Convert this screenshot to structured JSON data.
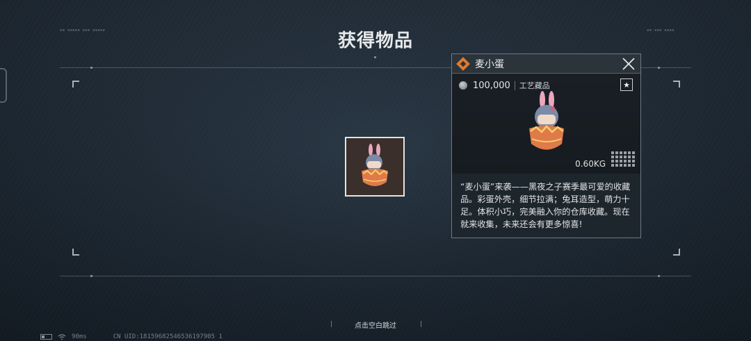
{
  "page": {
    "title": "获得物品",
    "bottom_hint": "点击空白跳过"
  },
  "item_card": {
    "name": "麦小蛋",
    "price": "100,000",
    "category": "工艺藏品",
    "weight": "0.60KG",
    "description": "“麦小蛋”来袭——黑夜之子赛季最可爱的收藏品。彩蛋外壳，细节拉满；兔耳造型，萌力十足。体积小巧，完美融入你的仓库收藏。现在就来收集，未来还会有更多惊喜!",
    "rarity_color": "#e07a2e",
    "icons": {
      "rarity": "diamond-rarity-icon",
      "close": "close-icon",
      "favorite": "star-icon",
      "currency": "coin-icon",
      "size": "grid-size-icon"
    }
  },
  "status_bar": {
    "ping": "90ms",
    "uid": "CN UID:18159682546536197905 1"
  }
}
